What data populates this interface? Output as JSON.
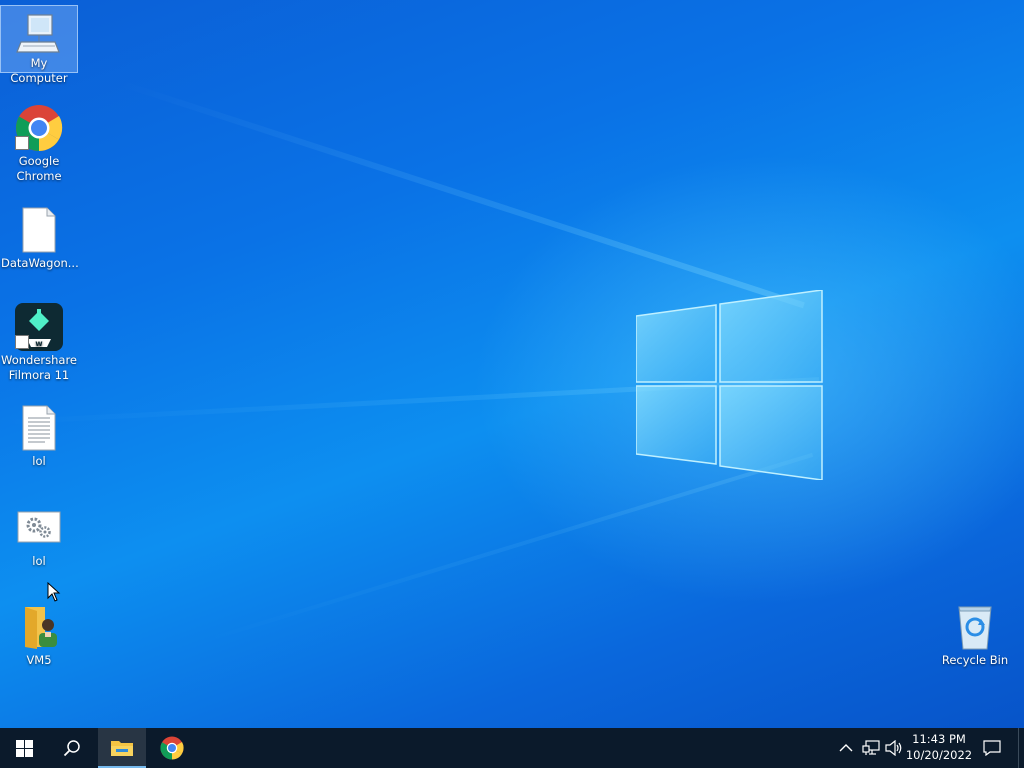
{
  "desktop_icons": [
    {
      "label": "My Computer"
    },
    {
      "label": "Google Chrome"
    },
    {
      "label": "DataWagon..."
    },
    {
      "label": "Wondershare Filmora 11"
    },
    {
      "label": "lol"
    },
    {
      "label": "lol"
    },
    {
      "label": "VM5"
    }
  ],
  "recycle_bin": {
    "label": "Recycle Bin"
  },
  "taskbar": {
    "clock_time": "11:43 PM",
    "clock_date": "10/20/2022",
    "pinned": [
      "start-icon",
      "search-icon",
      "file-explorer-icon",
      "chrome-icon"
    ],
    "tray": [
      "chevron-up-icon",
      "network-icon",
      "volume-icon",
      "notification-icon"
    ]
  },
  "colors": {
    "taskbar": "#0b1a2b",
    "accent": "#76b9ed",
    "wallpaper": "#0a72e6"
  }
}
